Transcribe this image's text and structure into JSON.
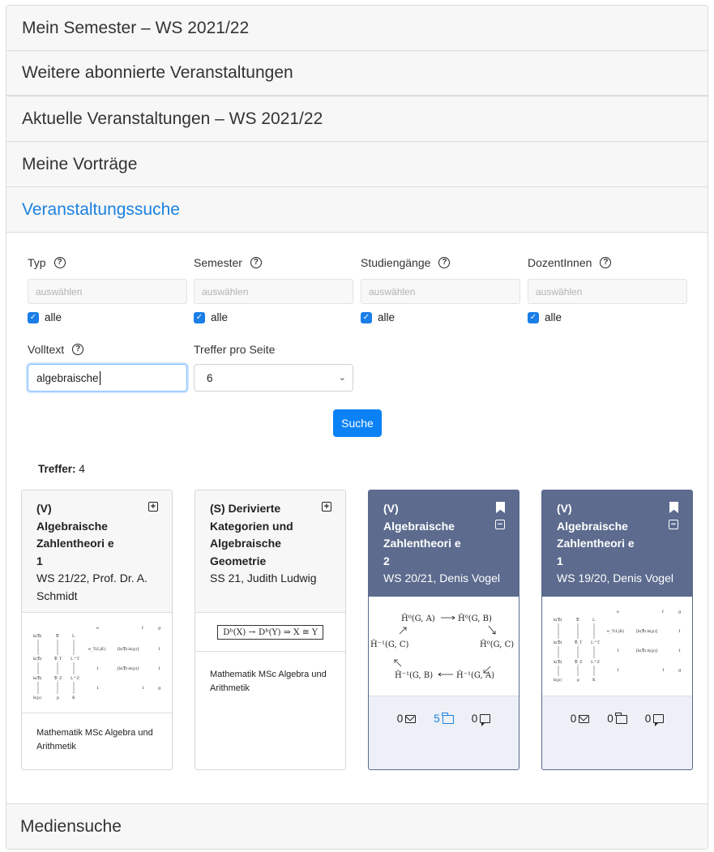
{
  "accordion": {
    "sections": [
      "Mein Semester – WS 2021/22",
      "Weitere abonnierte Veranstaltungen",
      "Aktuelle Veranstaltungen – WS 2021/22",
      "Meine Vorträge",
      "Veranstaltungssuche"
    ],
    "last": "Mediensuche"
  },
  "search": {
    "filters": [
      {
        "label": "Typ",
        "placeholder": "auswählen",
        "check": "alle"
      },
      {
        "label": "Semester",
        "placeholder": "auswählen",
        "check": "alle"
      },
      {
        "label": "Studiengänge",
        "placeholder": "auswählen",
        "check": "alle"
      },
      {
        "label": "DozentInnen",
        "placeholder": "auswählen",
        "check": "alle"
      }
    ],
    "fulltext_label": "Volltext",
    "fulltext_value": "algebraische",
    "per_page_label": "Treffer pro Seite",
    "per_page_value": "6",
    "submit": "Suche",
    "hits_label": "Treffer:",
    "hits_value": "4"
  },
  "cards": [
    {
      "type": "(V)",
      "title": "Algebraische Zahlentheori e 1",
      "sub": "WS 21/22, Prof. Dr. A. Schmidt",
      "foot": "Mathematik MSc Algebra und Arithmetik"
    },
    {
      "type": "(S)",
      "title": "Derivierte Kategorien und Algebraische Geometrie",
      "sub": "SS 21, Judith Ludwig",
      "foot": "Mathematik MSc Algebra und Arithmetik",
      "formula": "Dᵇ(X) → Dᵇ(Y)  ⇒  X ≅ Y"
    },
    {
      "type": "(V)",
      "title": "Algebraische Zahlentheori e 2",
      "sub": "WS 20/21, Denis Vogel",
      "stats": {
        "messages": "0",
        "files": "5",
        "comments": "0"
      },
      "diagram": {
        "top_left": "Ĥ⁰(G, A)",
        "top_right": "Ĥ⁰(G, B)",
        "mid_left": "Ĥ⁻¹(G, C)",
        "mid_right": "Ĥ⁰(G, C)",
        "bot_left": "Ĥ⁻¹(G, B)",
        "bot_right": "Ĥ⁻¹(G, A)"
      }
    },
    {
      "type": "(V)",
      "title": "Algebraische Zahlentheori e 1",
      "sub": "WS 19/20, Denis Vogel",
      "stats": {
        "messages": "0",
        "files": "0",
        "comments": "0"
      }
    }
  ]
}
